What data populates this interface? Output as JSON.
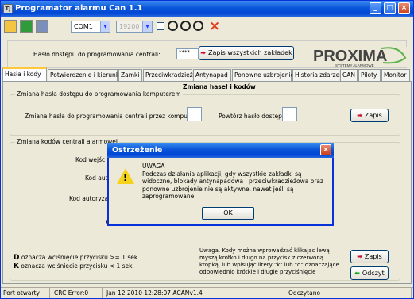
{
  "window": {
    "title": "Programator alarmu Can 1.1",
    "min_glyph": "_",
    "max_glyph": "□",
    "close_glyph": "×"
  },
  "toolbar": {
    "port": "COM1",
    "baud": "19200",
    "stop_glyph": "×"
  },
  "password_row": {
    "label": "Hasło dostępu do programowania centrali:",
    "value": "****",
    "save_all_label": "Zapis wszystkich zakładek",
    "logo_text": "PROXIMA",
    "logo_sub": "SYSTEMY ALARMOWE"
  },
  "tabs": [
    "Hasła i kody",
    "Potwierdzenie i kierunki",
    "Zamki",
    "Przeciwkradzież",
    "Antynapad",
    "Ponowne uzbrojenie",
    "Historia zdarzeń",
    "CAN",
    "Piloty",
    "Monitor"
  ],
  "panel": {
    "heading": "Zmiana haseł i kodów",
    "group1_legend": "Zmiana hasła dostępu do programowania komputerem",
    "pc_password_label": "Zmiana hasła do programowania centrali przez komputer:",
    "repeat_label": "Powtórz hasło dostępu:",
    "save1_label": "Zapis",
    "group2_legend": "Zmiana kodów centrali alarmowej",
    "kod_wejscia": "Kod wejśc",
    "kod_auto": "Kod auto",
    "kod_autoryzacji": "Kod autoryzacj",
    "k_label": "K",
    "note": "Uwaga. Kody można wprowadzać klikając lewą myszą krótko i długo na przycisk z czerwoną kropką, lub wpisując litery \"k\" lub \"d\" oznaczające odpowiednio krótkie i długie przyciśnięcie",
    "legend_d_key": "D",
    "legend_d": " oznacza wciśnięcie przycisku >= 1 sek.",
    "legend_k_key": "K",
    "legend_k": " oznacza wciśnięcie przycisku < 1 sek.",
    "save2_label": "Zapis",
    "read_label": "Odczyt"
  },
  "status": {
    "port": "Port otwarty",
    "crc": "CRC Error:0",
    "datetime": "Jan 12 2010  12:28:07 ACANv1.4",
    "read": "Odczytano"
  },
  "dialog": {
    "title": "Ostrzeżenie",
    "heading": "UWAGA !",
    "message": "Podczas działania aplikacji, gdy wszystkie zakładki są widoczne, blokady antynapadowa i przeciwkradzieżowa oraz ponowne uzbrojenie nie są aktywne, nawet jeśli są zaprogramowane.",
    "ok_label": "OK",
    "close_glyph": "×",
    "icon_glyph": "!"
  }
}
